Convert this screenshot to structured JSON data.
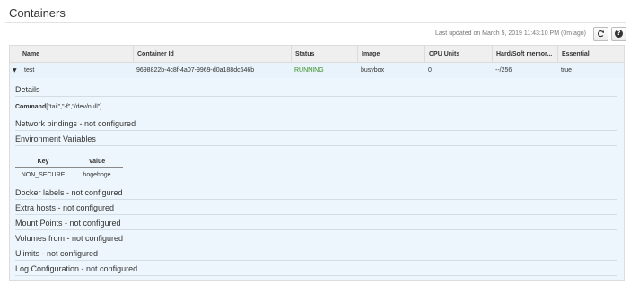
{
  "panel": {
    "title": "Containers",
    "last_updated": "Last updated on March 5, 2019 11:43:10 PM (0m ago)",
    "refresh_icon": "refresh-icon",
    "help_icon": "help-icon"
  },
  "table": {
    "columns": [
      "Name",
      "Container Id",
      "Status",
      "Image",
      "CPU Units",
      "Hard/Soft memor...",
      "Essential"
    ],
    "row": {
      "expand_icon": "caret-down-icon",
      "name": "test",
      "container_id": "9698822b-4c8f-4a07-9969-d0a188dc646b",
      "status": "RUNNING",
      "image": "busybox",
      "cpu_units": "0",
      "memory": "--/256",
      "essential": "true"
    }
  },
  "details": {
    "heading": "Details",
    "command_label": "Command",
    "command_value": "[\"tail\",\"-f\",\"/dev/null\"]",
    "network_bindings": "Network bindings - not configured",
    "env_heading": "Environment Variables",
    "env_columns": {
      "key": "Key",
      "value": "Value"
    },
    "env_vars": [
      {
        "key": "NON_SECURE",
        "value": "hogehoge"
      }
    ],
    "docker_labels": "Docker labels - not configured",
    "extra_hosts": "Extra hosts - not configured",
    "mount_points": "Mount Points - not configured",
    "volumes_from": "Volumes from - not configured",
    "ulimits": "Ulimits - not configured",
    "log_configuration": "Log Configuration - not configured"
  },
  "colors": {
    "status_running": "#3b8e23",
    "row_selected_bg": "#e8f3fb",
    "details_bg": "#edf6fc",
    "header_bg": "#efefef"
  }
}
